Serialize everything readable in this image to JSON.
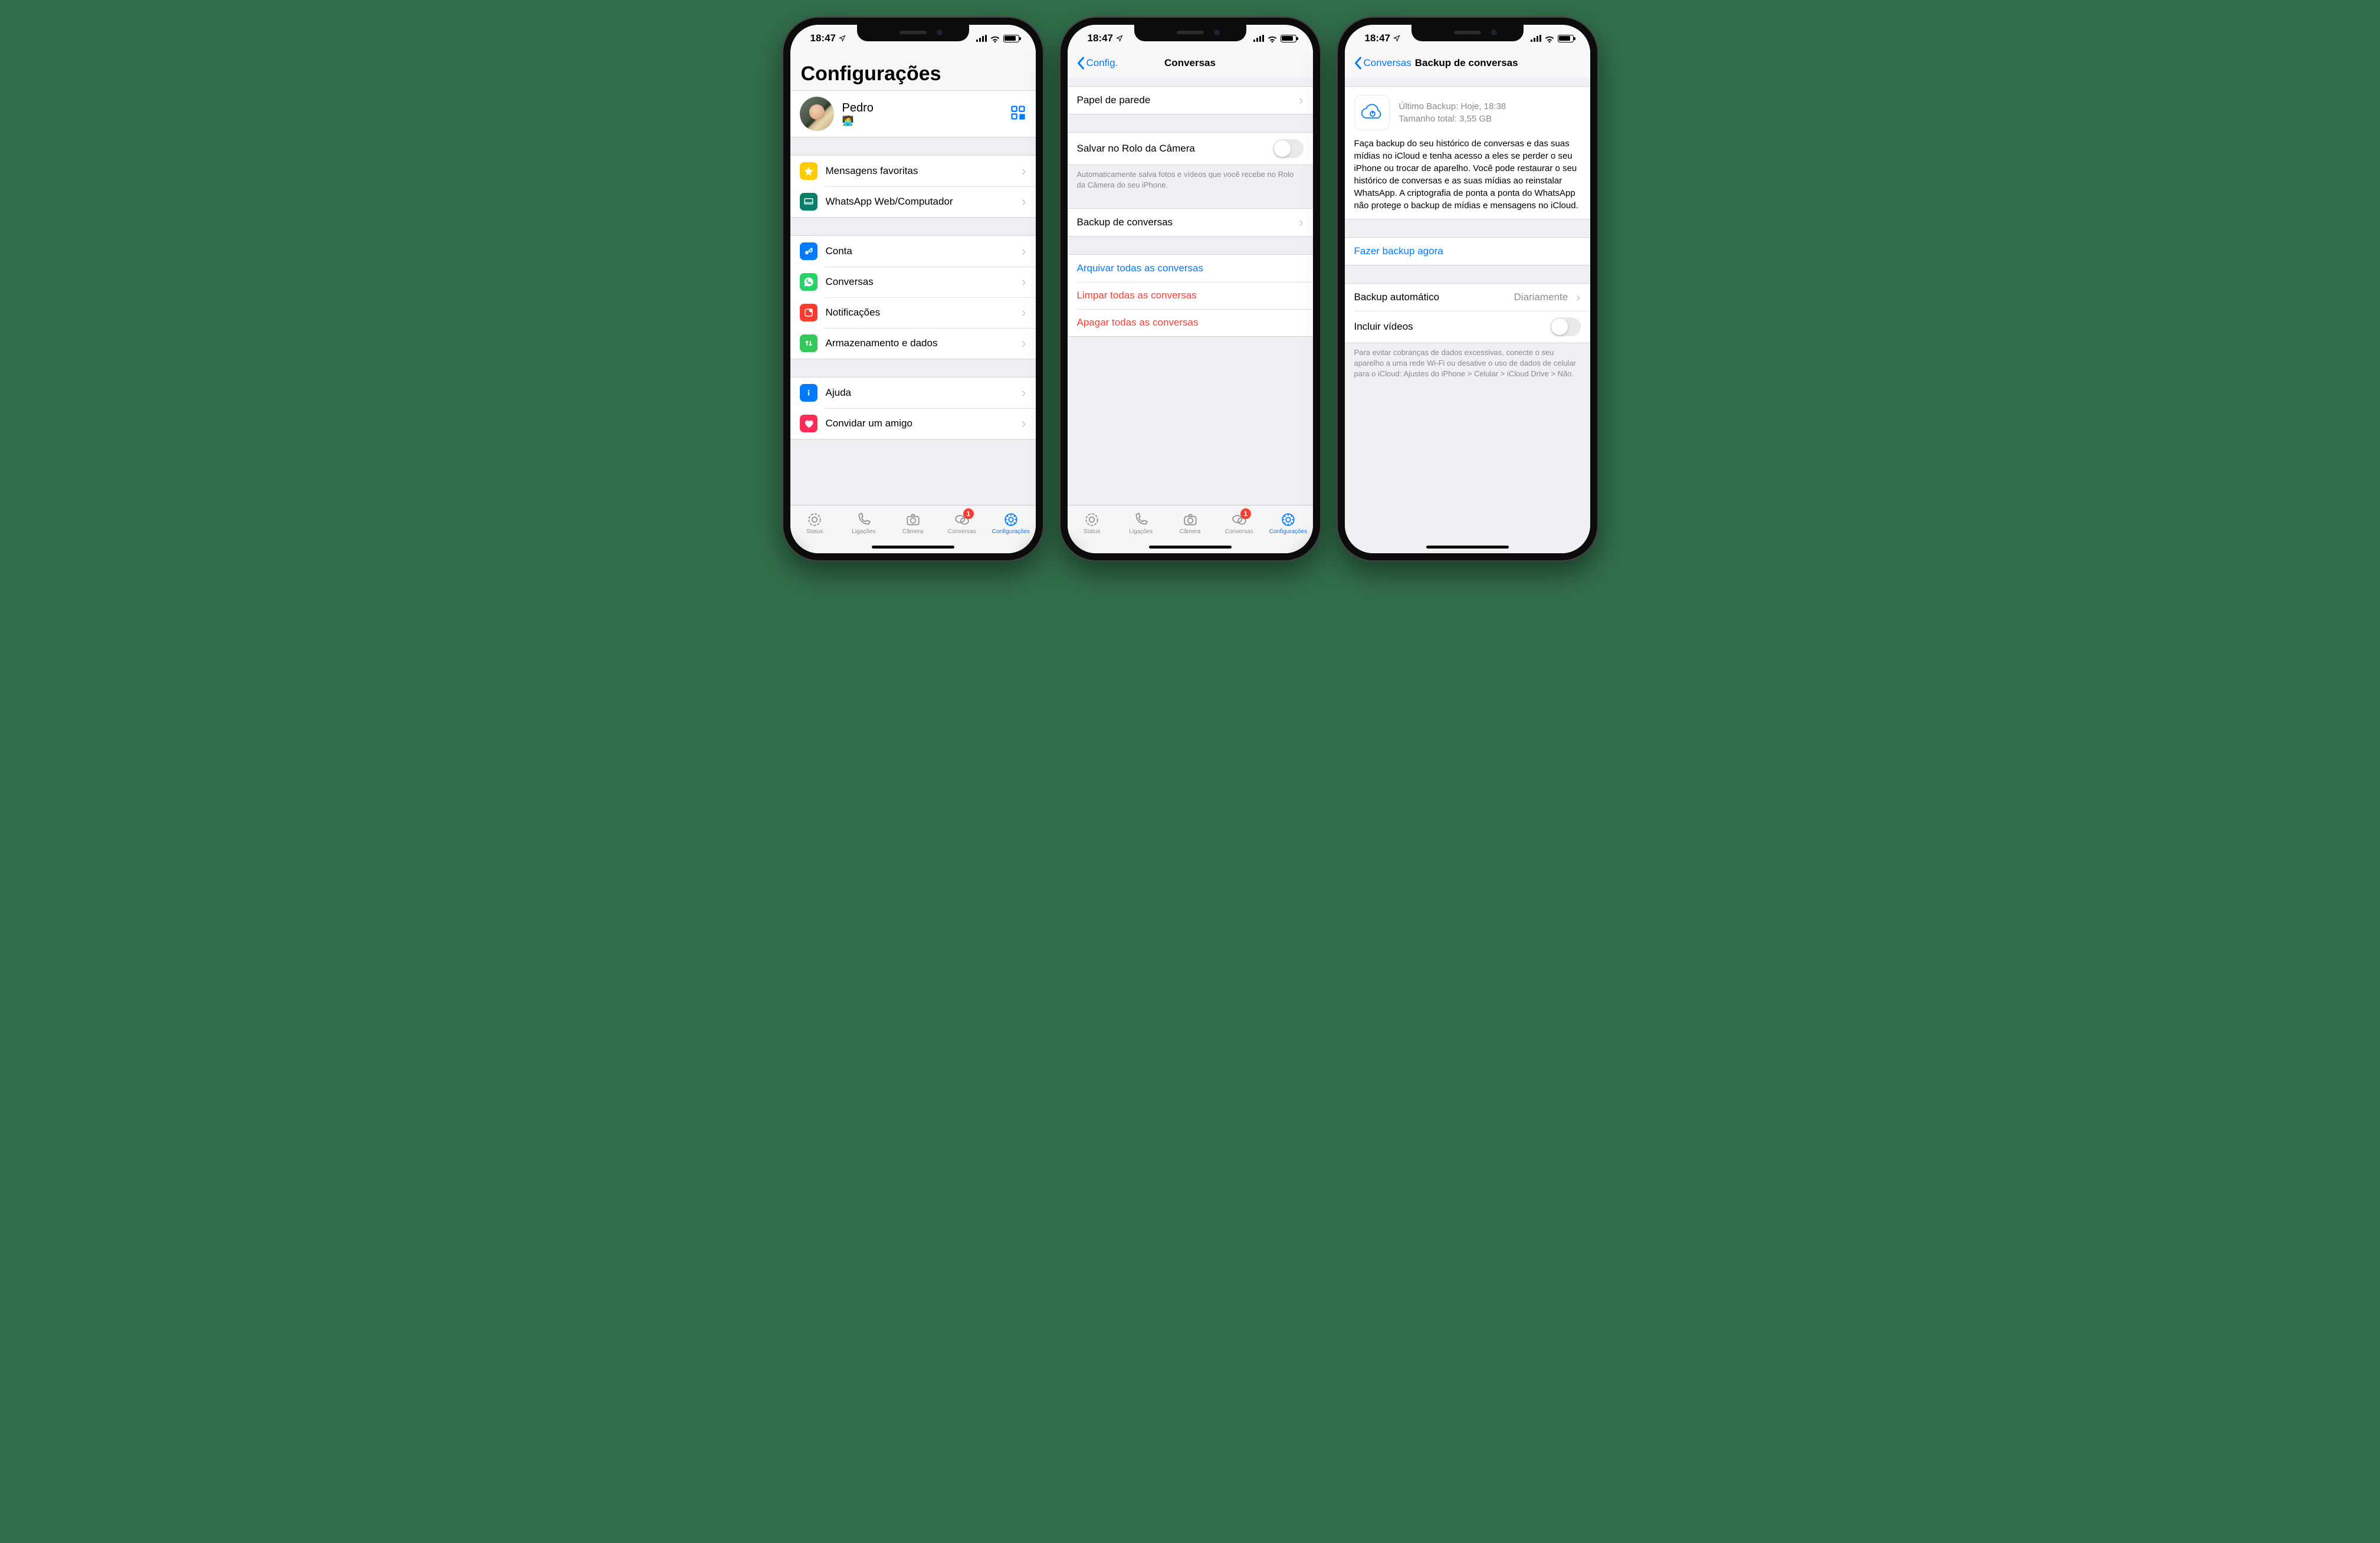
{
  "status": {
    "time": "18:47"
  },
  "tabs": {
    "status": "Status",
    "calls": "Ligações",
    "camera": "Câmera",
    "chats": "Conversas",
    "settings": "Configurações",
    "badge": "1"
  },
  "screen1": {
    "title": "Configurações",
    "profile": {
      "name": "Pedro",
      "status": "🧑‍💻"
    },
    "g1": {
      "starred": "Mensagens favoritas",
      "web": "WhatsApp Web/Computador"
    },
    "g2": {
      "account": "Conta",
      "chats": "Conversas",
      "notifications": "Notificações",
      "storage": "Armazenamento e dados"
    },
    "g3": {
      "help": "Ajuda",
      "invite": "Convidar um amigo"
    }
  },
  "screen2": {
    "back": "Config.",
    "title": "Conversas",
    "wallpaper": "Papel de parede",
    "saveRoll": "Salvar no Rolo da Câmera",
    "saveRollNote": "Automaticamente salva fotos e vídeos que você recebe no Rolo da Câmera do seu iPhone.",
    "backup": "Backup de conversas",
    "archive": "Arquivar todas as conversas",
    "clear": "Limpar todas as conversas",
    "delete": "Apagar todas as conversas"
  },
  "screen3": {
    "back": "Conversas",
    "title": "Backup de conversas",
    "lastBackup": "Último Backup: Hoje, 18:38",
    "totalSize": "Tamanho total: 3,55 GB",
    "desc": "Faça backup do seu histórico de conversas e das suas mídias no iCloud e tenha acesso a eles se perder o seu iPhone ou trocar de aparelho. Você pode restaurar o seu histórico de conversas e as suas mídias ao reinstalar WhatsApp. A criptografia de ponta a ponta do WhatsApp não protege o backup de mídias e mensagens no iCloud.",
    "backupNow": "Fazer backup agora",
    "auto": "Backup automático",
    "autoValue": "Diariamente",
    "includeVideos": "Incluir vídeos",
    "footerNote": "Para evitar cobranças de dados excessivas, conecte o seu aparelho a uma rede Wi-Fi ou desative o uso de dados de celular para o iCloud: Ajustes do iPhone > Celular > iCloud Drive > Não."
  }
}
